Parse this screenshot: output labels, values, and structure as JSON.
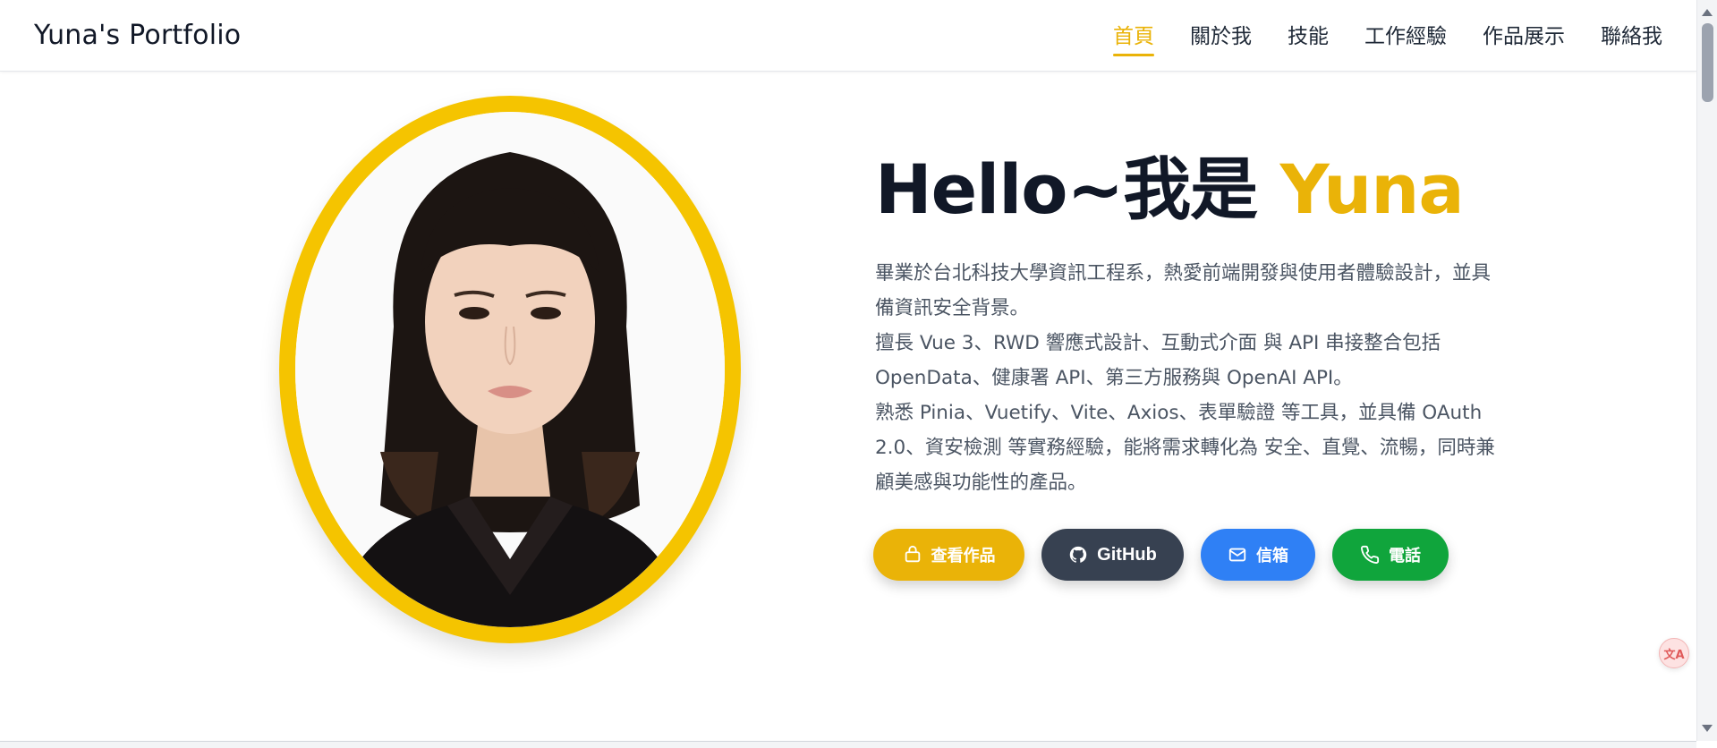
{
  "header": {
    "brand": "Yuna's Portfolio",
    "nav": [
      {
        "label": "首頁",
        "active": true
      },
      {
        "label": "關於我",
        "active": false
      },
      {
        "label": "技能",
        "active": false
      },
      {
        "label": "工作經驗",
        "active": false
      },
      {
        "label": "作品展示",
        "active": false
      },
      {
        "label": "聯絡我",
        "active": false
      }
    ]
  },
  "hero": {
    "title_prefix": "Hello~我是 ",
    "title_name": "Yuna",
    "paragraphs": [
      "畢業於台北科技大學資訊工程系，熱愛前端開發與使用者體驗設計，並具備資訊安全背景。",
      "擅長 Vue 3、RWD 響應式設計、互動式介面 與 API 串接整合包括 OpenData、健康署 API、第三方服務與 OpenAI API。",
      "熟悉 Pinia、Vuetify、Vite、Axios、表單驗證 等工具，並具備 OAuth 2.0、資安檢測 等實務經驗，能將需求轉化為 安全、直覺、流暢，同時兼顧美感與功能性的產品。"
    ]
  },
  "buttons": {
    "works": "查看作品",
    "github": "GitHub",
    "mail": "信箱",
    "phone": "電話"
  },
  "icons": {
    "works": "briefcase-icon",
    "github": "github-icon",
    "mail": "envelope-icon",
    "phone": "phone-icon",
    "translate": "translate-icon"
  },
  "colors": {
    "accent": "#eab308",
    "ring": "#f5c400",
    "github_btn": "#374151",
    "mail_btn": "#2f80f5",
    "phone_btn": "#10a53c"
  }
}
